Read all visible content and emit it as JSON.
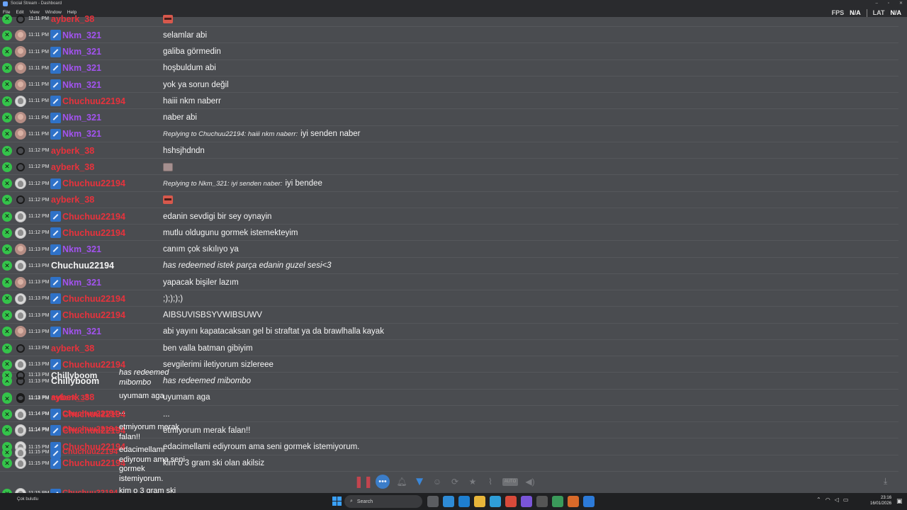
{
  "window": {
    "title": "Social Stream - Dashboard"
  },
  "menu": [
    "File",
    "Edit",
    "View",
    "Window",
    "Help"
  ],
  "stats": {
    "fps_label": "FPS",
    "fps_value": "N/A",
    "lat_label": "LAT",
    "lat_value": "N/A"
  },
  "messages": [
    {
      "time": "11:11 PM",
      "user": "ayberk_38",
      "color": "red",
      "avatar": "user",
      "badge": false,
      "emote": "red"
    },
    {
      "time": "11:11 PM",
      "user": "Nkm_321",
      "color": "purple",
      "avatar": "nkm",
      "badge": true,
      "text": "selamlar abi"
    },
    {
      "time": "11:11 PM",
      "user": "Nkm_321",
      "color": "purple",
      "avatar": "nkm",
      "badge": true,
      "text": "galiba görmedin"
    },
    {
      "time": "11:11 PM",
      "user": "Nkm_321",
      "color": "purple",
      "avatar": "nkm",
      "badge": true,
      "text": "hoşbuldum abi"
    },
    {
      "time": "11:11 PM",
      "user": "Nkm_321",
      "color": "purple",
      "avatar": "nkm",
      "badge": true,
      "text": "yok ya sorun değil"
    },
    {
      "time": "11:11 PM",
      "user": "Chuchuu22194",
      "color": "red",
      "avatar": "chu",
      "badge": true,
      "text": "haiii nkm naberr"
    },
    {
      "time": "11:11 PM",
      "user": "Nkm_321",
      "color": "purple",
      "avatar": "nkm",
      "badge": true,
      "text": "naber abi"
    },
    {
      "time": "11:11 PM",
      "user": "Nkm_321",
      "color": "purple",
      "avatar": "nkm",
      "badge": true,
      "reply": "Replying to Chuchuu22194: haiii nkm naberr:",
      "text": "iyi senden naber"
    },
    {
      "time": "11:12 PM",
      "user": "ayberk_38",
      "color": "red",
      "avatar": "user",
      "badge": false,
      "text": "hshsjhdndn"
    },
    {
      "time": "11:12 PM",
      "user": "ayberk_38",
      "color": "red",
      "avatar": "user",
      "badge": false,
      "emote": "grey"
    },
    {
      "time": "11:12 PM",
      "user": "Chuchuu22194",
      "color": "red",
      "avatar": "chu",
      "badge": true,
      "reply": "Replying to Nkm_321: iyi senden naber:",
      "text": "iyi bendee"
    },
    {
      "time": "11:12 PM",
      "user": "ayberk_38",
      "color": "red",
      "avatar": "user",
      "badge": false,
      "emote": "red"
    },
    {
      "time": "11:12 PM",
      "user": "Chuchuu22194",
      "color": "red",
      "avatar": "chu",
      "badge": true,
      "text": "edanin sevdigi bir sey oynayin"
    },
    {
      "time": "11:12 PM",
      "user": "Chuchuu22194",
      "color": "red",
      "avatar": "chu",
      "badge": true,
      "text": "mutlu oldugunu gormek istemekteyim"
    },
    {
      "time": "11:13 PM",
      "user": "Nkm_321",
      "color": "purple",
      "avatar": "nkm",
      "badge": true,
      "text": "canım çok sıkılıyo ya"
    },
    {
      "time": "11:13 PM",
      "user": "Chuchuu22194",
      "color": "white",
      "avatar": "chu",
      "badge": false,
      "italic": true,
      "text": "has redeemed istek parça edanin guzel sesi<3"
    },
    {
      "time": "11:13 PM",
      "user": "Nkm_321",
      "color": "purple",
      "avatar": "nkm",
      "badge": true,
      "text": "yapacak bişiler lazım"
    },
    {
      "time": "11:13 PM",
      "user": "Chuchuu22194",
      "color": "red",
      "avatar": "chu",
      "badge": true,
      "text": ";);););)"
    },
    {
      "time": "11:13 PM",
      "user": "Chuchuu22194",
      "color": "red",
      "avatar": "chu",
      "badge": true,
      "text": "AIBSUVISBSYVWIBSUWV"
    },
    {
      "time": "11:13 PM",
      "user": "Nkm_321",
      "color": "purple",
      "avatar": "nkm",
      "badge": true,
      "text": "abi yayını kapatacaksan gel bi straftat ya da brawlhalla kayak"
    },
    {
      "time": "11:13 PM",
      "user": "ayberk_38",
      "color": "red",
      "avatar": "user",
      "badge": false,
      "text": "ben valla batman gibiyim"
    },
    {
      "time": "11:13 PM",
      "user": "Chuchuu22194",
      "color": "red",
      "avatar": "chu",
      "badge": true,
      "text": "sevgilerimi iletiyorum sizlereee"
    },
    {
      "time": "11:13 PM",
      "user": "Chillyboom",
      "color": "white",
      "avatar": "user",
      "badge": false,
      "italic": true,
      "text": "has redeemed mibombo"
    },
    {
      "time": "11:13 PM",
      "user": "ayberk_38",
      "color": "red",
      "avatar": "user",
      "badge": false,
      "text": "uyumam aga"
    },
    {
      "time": "11:14 PM",
      "user": "Chuchuu22194",
      "color": "red",
      "avatar": "chu",
      "badge": true,
      "text": "..."
    },
    {
      "time": "11:14 PM",
      "user": "Chuchuu22194",
      "color": "red",
      "avatar": "chu",
      "badge": true,
      "text": "etmiyorum merak falan!!"
    },
    {
      "time": "11:15 PM",
      "user": "Chuchuu22194",
      "color": "red",
      "avatar": "chu",
      "badge": true,
      "text": "edacimellami ediyroum ama seni gormek istemiyorum."
    },
    {
      "time": "11:15 PM",
      "user": "Chuchuu22194",
      "color": "red",
      "avatar": "chu",
      "badge": true,
      "text": "kim o 3 gram ski olan akilsiz"
    }
  ],
  "overlay": {
    "messages": [
      {
        "time": "11:13 PM",
        "user": "Chillyboom",
        "color": "white",
        "avatar": "user",
        "badge": false,
        "lines": [
          "has redeemed",
          "mibombo"
        ],
        "italic": true
      },
      {
        "time": "11:13 PM",
        "user": "ayberk_38",
        "color": "red",
        "avatar": "user",
        "badge": false,
        "lines": [
          "uyumam aga"
        ]
      },
      {
        "time": "11:14 PM",
        "user": "Chuchuu22194",
        "color": "red",
        "avatar": "chu",
        "badge": true,
        "lines": [
          "..."
        ]
      },
      {
        "time": "11:14 PM",
        "user": "Chuchuu22194",
        "color": "red",
        "avatar": "chu",
        "badge": true,
        "lines": [
          "etmiyorum merak",
          "falan!!"
        ]
      },
      {
        "time": "11:15 PM",
        "user": "Chuchuu22194",
        "color": "red",
        "avatar": "chu",
        "badge": true,
        "lines": [
          "edacimellami",
          "ediyroum ama seni",
          "gormek",
          "istemiyorum."
        ]
      },
      {
        "time": "11:15 PM",
        "user": "Chuchuu22194",
        "color": "red",
        "avatar": "chu",
        "badge": true,
        "lines": [
          "kim o 3 gram ski",
          "olan akilsiz"
        ]
      }
    ]
  },
  "toolbar": {
    "icons": [
      "pause-icon",
      "chat-bubble-icon",
      "bell-icon",
      "filter-icon",
      "emoji-icon",
      "refresh-icon",
      "star-icon",
      "broom-icon",
      "auto-icon",
      "speaker-icon"
    ],
    "auto_label": "AUTO"
  },
  "taskbar": {
    "weather": "Çok bulutlu",
    "search_placeholder": "Search",
    "time": "23:16",
    "date": "16/01/2026"
  }
}
